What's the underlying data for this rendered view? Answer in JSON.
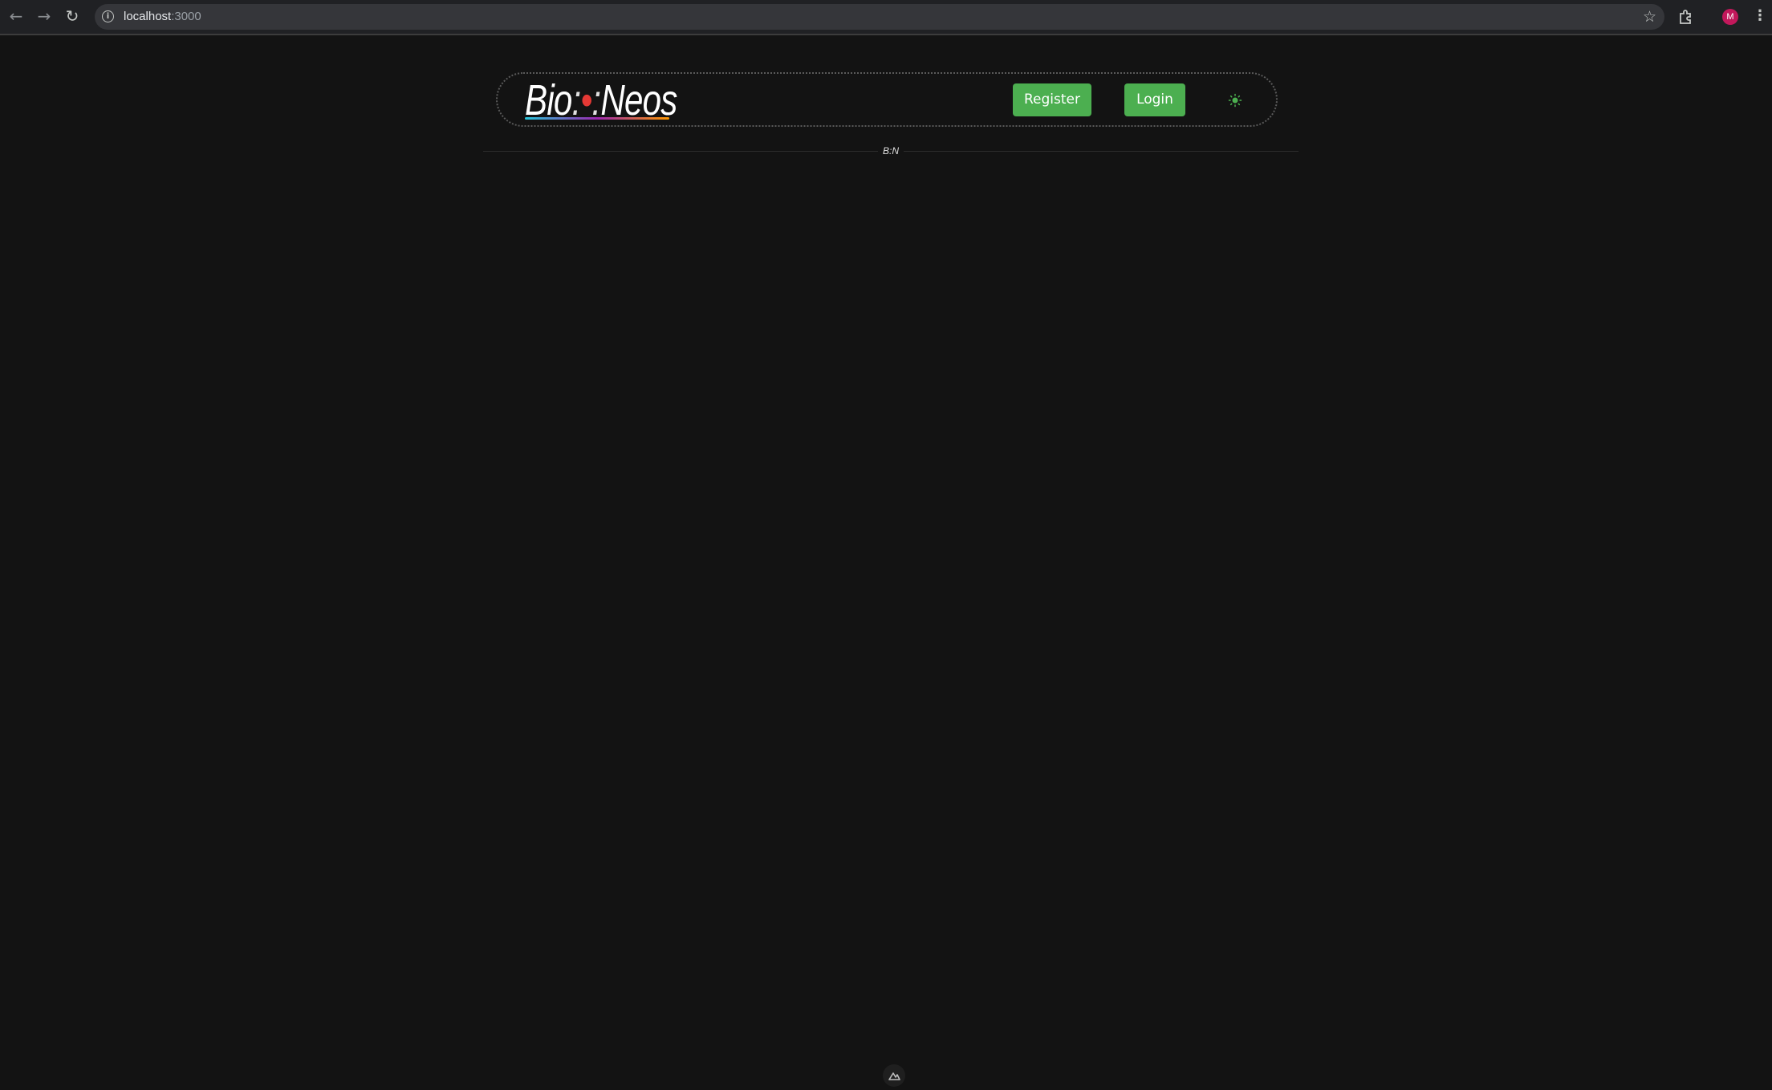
{
  "browser": {
    "url_host": "localhost",
    "url_port": ":3000",
    "profile_initial": "M"
  },
  "header": {
    "logo_left": "Bio",
    "logo_sep": ":",
    "logo_dot": "•",
    "logo_sep2": ":",
    "logo_right": "Neos",
    "register_label": "Register",
    "login_label": "Login"
  },
  "divider": {
    "badge": "B:N"
  },
  "colors": {
    "background": "#131313",
    "button_green": "#4caf50",
    "toggle_green": "#4caf50"
  }
}
